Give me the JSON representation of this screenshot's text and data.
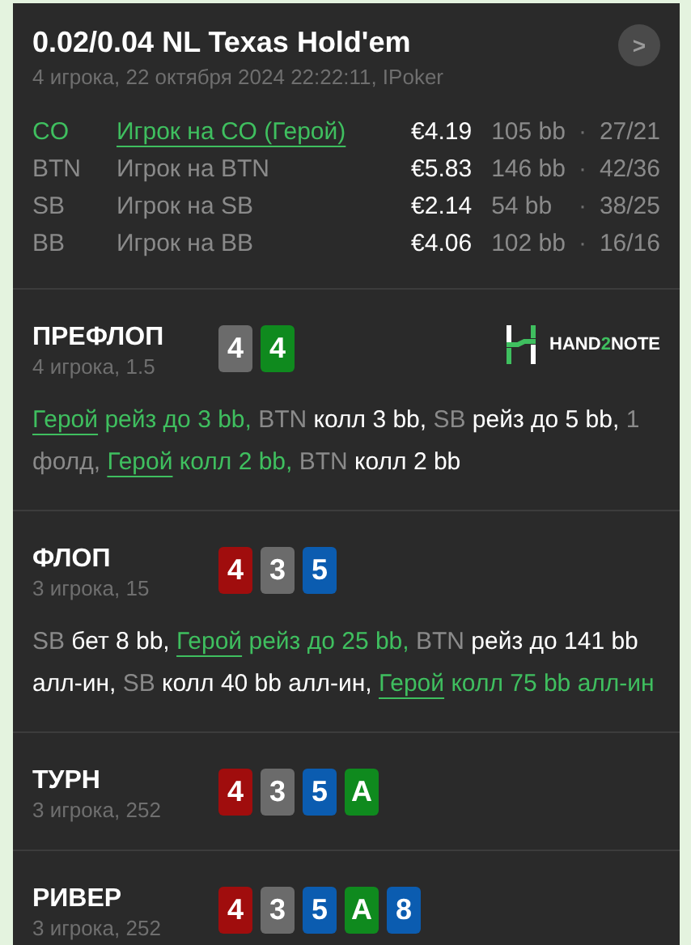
{
  "header": {
    "title": "0.02/0.04 NL Texas Hold'em",
    "subtitle": "4 игрока, 22 октября 2024 22:22:11, IPoker",
    "next_button": ">"
  },
  "players": [
    {
      "position": "CO",
      "name": "Игрок на CO (Герой)",
      "hero": true,
      "stack": "€4.19",
      "bb": "105 bb",
      "sep": "·",
      "stats": "27/21"
    },
    {
      "position": "BTN",
      "name": "Игрок на BTN",
      "hero": false,
      "stack": "€5.83",
      "bb": "146 bb",
      "sep": "·",
      "stats": "42/36"
    },
    {
      "position": "SB",
      "name": "Игрок на SB",
      "hero": false,
      "stack": "€2.14",
      "bb": "54 bb",
      "sep": "·",
      "stats": "38/25"
    },
    {
      "position": "BB",
      "name": "Игрок на BB",
      "hero": false,
      "stack": "€4.06",
      "bb": "102 bb",
      "sep": "·",
      "stats": "16/16"
    }
  ],
  "streets": [
    {
      "name": "ПРЕФЛОП",
      "info": "4 игрока, 1.5",
      "logo": {
        "text_a": "HAND",
        "text_b": "2",
        "text_c": "NOTE"
      },
      "cards": [
        {
          "rank": "4",
          "color": "#6b6b6b"
        },
        {
          "rank": "4",
          "color": "#0f8a1e"
        }
      ],
      "actions": [
        {
          "kind": "hero",
          "text": "Герой"
        },
        {
          "kind": "hero_action",
          "text": " рейз до 3 bb, "
        },
        {
          "kind": "player",
          "text": "BTN"
        },
        {
          "kind": "action",
          "text": " колл 3 bb, "
        },
        {
          "kind": "player",
          "text": "SB"
        },
        {
          "kind": "action",
          "text": " рейз до 5 bb, "
        },
        {
          "kind": "player",
          "text": "1 фолд, "
        },
        {
          "kind": "hero",
          "text": "Герой"
        },
        {
          "kind": "hero_action",
          "text": " колл 2 bb, "
        },
        {
          "kind": "player",
          "text": "BTN"
        },
        {
          "kind": "action",
          "text": " колл 2 bb"
        }
      ]
    },
    {
      "name": "ФЛОП",
      "info": "3 игрока, 15",
      "cards": [
        {
          "rank": "4",
          "color": "#a00d0d"
        },
        {
          "rank": "3",
          "color": "#6b6b6b"
        },
        {
          "rank": "5",
          "color": "#0b5cb0"
        }
      ],
      "actions": [
        {
          "kind": "player",
          "text": "SB"
        },
        {
          "kind": "action",
          "text": " бет 8 bb, "
        },
        {
          "kind": "hero",
          "text": "Герой"
        },
        {
          "kind": "hero_action",
          "text": " рейз до 25 bb, "
        },
        {
          "kind": "player",
          "text": "BTN"
        },
        {
          "kind": "action",
          "text": " рейз до 141 bb алл-ин, "
        },
        {
          "kind": "player",
          "text": "SB"
        },
        {
          "kind": "action",
          "text": " колл 40 bb алл-ин, "
        },
        {
          "kind": "hero",
          "text": "Герой"
        },
        {
          "kind": "hero_action",
          "text": " колл 75 bb алл-ин"
        }
      ]
    },
    {
      "name": "ТУРН",
      "info": "3 игрока, 252",
      "cards": [
        {
          "rank": "4",
          "color": "#a00d0d"
        },
        {
          "rank": "3",
          "color": "#6b6b6b"
        },
        {
          "rank": "5",
          "color": "#0b5cb0"
        },
        {
          "rank": "A",
          "color": "#0f8a1e"
        }
      ]
    },
    {
      "name": "РИВЕР",
      "info": "3 игрока, 252",
      "cards": [
        {
          "rank": "4",
          "color": "#a00d0d"
        },
        {
          "rank": "3",
          "color": "#6b6b6b"
        },
        {
          "rank": "5",
          "color": "#0b5cb0"
        },
        {
          "rank": "A",
          "color": "#0f8a1e"
        },
        {
          "rank": "8",
          "color": "#0b5cb0"
        }
      ]
    }
  ]
}
